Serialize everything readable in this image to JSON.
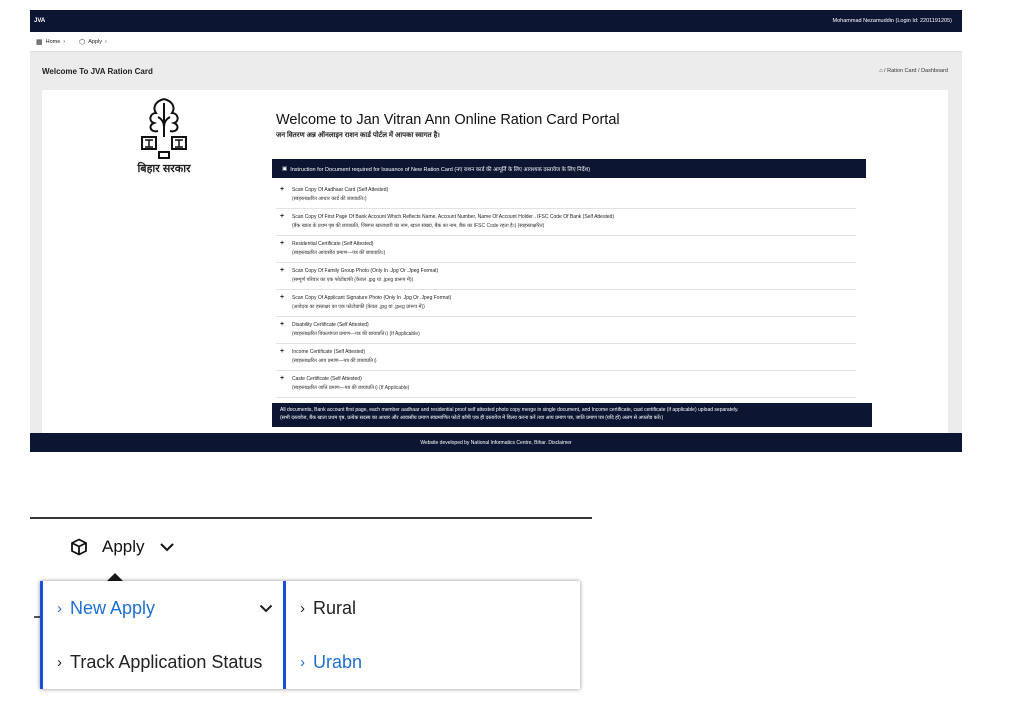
{
  "top": {
    "app": "JVA",
    "user": "Mohammad Nezamuddin (Login Id: 2201191205)",
    "nav": [
      {
        "label": "Home"
      },
      {
        "label": "Apply"
      }
    ],
    "page_title": "Welcome To JVA Ration Card",
    "breadcrumb": [
      "Ration Card",
      "Dashboard"
    ],
    "emblem_caption": "बिहार सरकार",
    "welcome_title": "Welcome to Jan Vitran Ann Online Ration Card Portal",
    "welcome_sub": "जन वितरण अन्न ऑनलाइन राशन कार्ड पोर्टल में आपका स्वागत है।",
    "instruction_header": "Instruction for Document required for Issuance of New Ration Card (नए राशन कार्ड की आपूर्ति के लिए आवश्यक दस्तावेज के लिए निर्देश)",
    "documents": [
      {
        "en": "Scan Copy Of Aadhaar Card (Self Attested)",
        "hi": "(स्वहस्ताक्षरित आधार कार्ड की छायाप्रति।)"
      },
      {
        "en": "Scan Copy Of First Page Of Bank Account Which Reflects Name, Account Number, Name Of Account Holder , IFSC Code Of Bank (Self Attested)",
        "hi": "(बैंक खाता के प्रथम पृष्ठ की छायाप्रति, जिसपर खाताधारी का नाम, खाता संख्या, बैंक का नाम, बैंक का IFSC Code रहता है।) (स्वहस्ताक्षरित)"
      },
      {
        "en": "Residential Certificate (Self Attested)",
        "hi": "(स्वहस्ताक्षरित आवासीय प्रमाण—पत्र की छायाप्रति।)"
      },
      {
        "en": "Scan Copy Of Family Group Photo (Only In .Jpg Or .Jpeg Format)",
        "hi": "(सम्पूर्ण परिवार का एक फोटोग्राफी (केवल .jpg या .jpeg प्रारूप में))"
      },
      {
        "en": "Scan Copy Of Applicant Signature Photo (Only In .Jpg Or .Jpeg Format)",
        "hi": "(आवेदक का हस्ताक्षर का एक फोटोग्राफी (केवल .jpg या .jpeg प्रारूप में))"
      },
      {
        "en": "Disability Certificate (Self Attested)",
        "hi": "(स्वहस्ताक्षरित विकलांगता प्रमाण—पत्र की छायाप्रति।) (If Applicable)"
      },
      {
        "en": "Income Certificate (Self Attested)",
        "hi": "(स्वहस्ताक्षरित आय प्रमाण—पत्र की छायाप्रति।)"
      },
      {
        "en": "Caste Certificate (Self Attested)",
        "hi": "(स्वहस्ताक्षरित जाति प्रमाण—पत्र की छायाप्रति।) (If Applicable)"
      }
    ],
    "note_en": "All documents, Bank account first page, each member aadhaar and residential proof self attested photo copy merge in single document, and Income certificate, cast certificate (if applicable) upload separately.",
    "note_hi": "(सभी दस्तावेज, बैंक खाता प्रथम पृष्ठ, प्रत्येक सदस्य का आधार और आवासीय प्रमाण स्वप्रमाणित फोटो कॉपी एक ही दस्तावेज में विलय करना करें तथा आय प्रमाण पत्र, जाति प्रमाण पत्र (यदि हो) अलग से अपलोड करें।)",
    "footer": "Website developed by National Informatics Centre, Bihar. Disclaimer"
  },
  "zoom": {
    "apply_label": "Apply",
    "menu_left": [
      {
        "label": "New Apply"
      },
      {
        "label": "Track Application Status"
      }
    ],
    "menu_right": [
      {
        "label": "Rural"
      },
      {
        "label": "Urabn"
      }
    ],
    "accent": "#1f6fd1"
  }
}
